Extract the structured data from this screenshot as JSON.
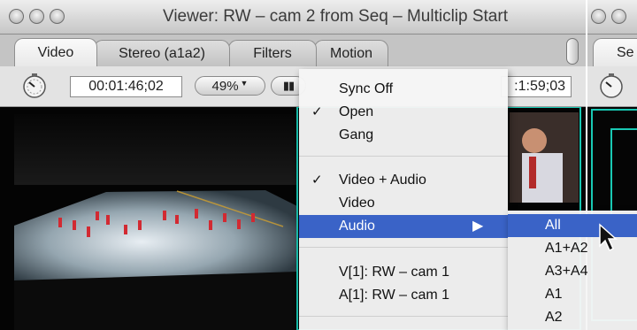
{
  "viewer": {
    "title": "Viewer: RW – cam 2 from  Seq – Multiclip Start",
    "tabs": [
      {
        "label": "Video",
        "active": true
      },
      {
        "label": "Stereo (a1a2)",
        "active": false
      },
      {
        "label": "Filters",
        "active": false
      },
      {
        "label": "Motion",
        "active": false
      }
    ],
    "timecode_duration": "00:01:46;02",
    "zoom": "49%",
    "timecode_current": ":1:59;03"
  },
  "right_window": {
    "tab_partial": "Se"
  },
  "context_menu": {
    "items": [
      {
        "label": "Sync Off",
        "checked": false
      },
      {
        "label": "Open",
        "checked": true
      },
      {
        "label": "Gang",
        "checked": false
      },
      {
        "label": "Video + Audio",
        "checked": true
      },
      {
        "label": "Video",
        "checked": false
      },
      {
        "label": "Audio",
        "checked": false,
        "highlighted": true,
        "has_submenu": true
      },
      {
        "label": "V[1]: RW – cam 1",
        "checked": false
      },
      {
        "label": "A[1]: RW – cam 1",
        "checked": false
      }
    ],
    "check_glyph": "✓",
    "submenu_arrow": "▶"
  },
  "audio_submenu": {
    "items": [
      {
        "label": "All",
        "highlighted": true
      },
      {
        "label": "A1+A2"
      },
      {
        "label": "A3+A4"
      },
      {
        "label": "A1"
      },
      {
        "label": "A2"
      }
    ]
  },
  "colors": {
    "highlight": "#3a63c7",
    "multiclip_border": "#19c9b4"
  }
}
